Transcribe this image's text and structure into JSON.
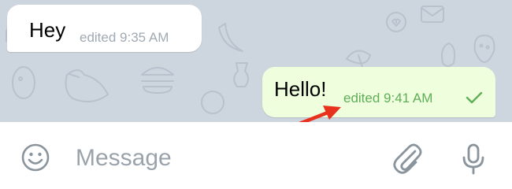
{
  "messages": [
    {
      "direction": "incoming",
      "text": "Hey",
      "meta": "edited 9:35 AM"
    },
    {
      "direction": "outgoing",
      "text": "Hello!",
      "meta": "edited 9:41 AM",
      "status": "sent-check-icon"
    }
  ],
  "composer": {
    "placeholder": "Message",
    "icons": [
      "emoji-icon",
      "attach-paperclip-icon",
      "microphone-icon"
    ]
  },
  "colors": {
    "chat_background": "#cdd6df",
    "incoming_bubble": "#ffffff",
    "outgoing_bubble": "#efffde",
    "outgoing_meta": "#5fae57",
    "annotation_arrow": "#e8321e"
  }
}
